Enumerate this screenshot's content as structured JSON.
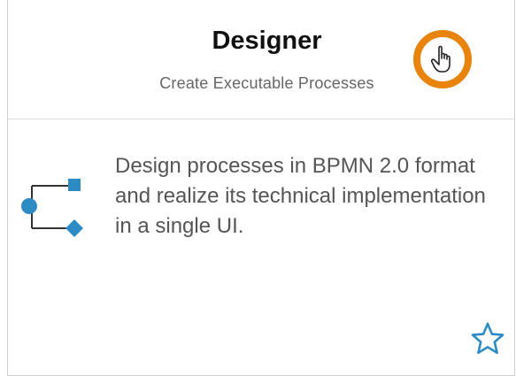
{
  "tile": {
    "title": "Designer",
    "subtitle": "Create Executable Processes",
    "description": "Design processes in BPMN 2.0 format and realize its technical implementation in a single UI.",
    "icon": "bpmn-flow-icon",
    "favorite_icon": "star-outline-icon",
    "cursor_icon": "hand-pointer-icon"
  },
  "colors": {
    "accent": "#2d8bc4",
    "highlight_ring": "#e8830c",
    "title_text": "#111111",
    "muted_text": "#666666",
    "body_text": "#555555"
  }
}
